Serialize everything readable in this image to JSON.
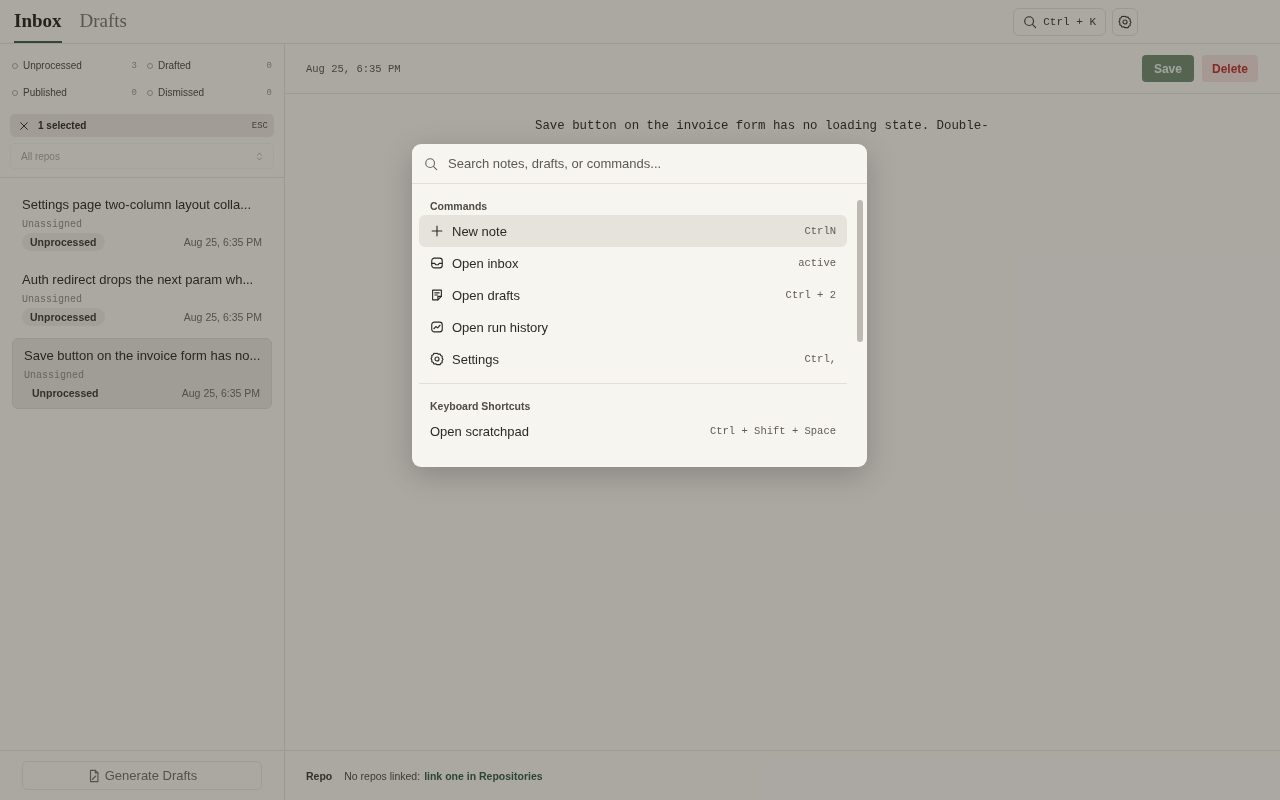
{
  "tabs": [
    {
      "label": "Inbox",
      "selected": true
    },
    {
      "label": "Drafts",
      "selected": false
    }
  ],
  "search_shortcut": "Ctrl + K",
  "filters": [
    {
      "label": "Unprocessed",
      "count": "3"
    },
    {
      "label": "Drafted",
      "count": "0"
    },
    {
      "label": "Published",
      "count": "0"
    },
    {
      "label": "Dismissed",
      "count": "0"
    }
  ],
  "selection": {
    "label": "1 selected",
    "key": "ESC"
  },
  "repo_select": {
    "placeholder": "All repos"
  },
  "notes": [
    {
      "title": "Settings page two-column layout colla...",
      "assignee": "Unassigned",
      "status": "Unprocessed",
      "time": "Aug 25, 6:35 PM",
      "selected": false
    },
    {
      "title": "Auth redirect drops the next param wh...",
      "assignee": "Unassigned",
      "status": "Unprocessed",
      "time": "Aug 25, 6:35 PM",
      "selected": false
    },
    {
      "title": "Save button on the invoice form has no...",
      "assignee": "Unassigned",
      "status": "Unprocessed",
      "time": "Aug 25, 6:35 PM",
      "selected": true
    }
  ],
  "generate_button": "Generate Drafts",
  "detail": {
    "timestamp": "Aug 25, 6:35 PM",
    "save": "Save",
    "delete": "Delete",
    "body": "Save button on the invoice form has no loading state. Double-"
  },
  "footer": {
    "label": "Repo",
    "text": "No repos linked:",
    "link": "link one in Repositories"
  },
  "palette": {
    "placeholder": "Search notes, drafts, or commands...",
    "sections": [
      {
        "title": "Commands",
        "items": [
          {
            "kind": "plus",
            "label": "New note",
            "shortcut": "CtrlN",
            "selected": true
          },
          {
            "kind": "inbox",
            "label": "Open inbox",
            "shortcut": "active",
            "selected": false
          },
          {
            "kind": "draft",
            "label": "Open drafts",
            "shortcut": "Ctrl + 2",
            "selected": false
          },
          {
            "kind": "chart",
            "label": "Open run history",
            "selected": false
          },
          {
            "kind": "gear",
            "label": "Settings",
            "shortcut": "Ctrl,",
            "selected": false
          }
        ]
      },
      {
        "title": "Keyboard Shortcuts",
        "items": [
          {
            "label": "Open scratchpad",
            "shortcut": "Ctrl + Shift + Space",
            "selected": false
          }
        ]
      }
    ]
  }
}
